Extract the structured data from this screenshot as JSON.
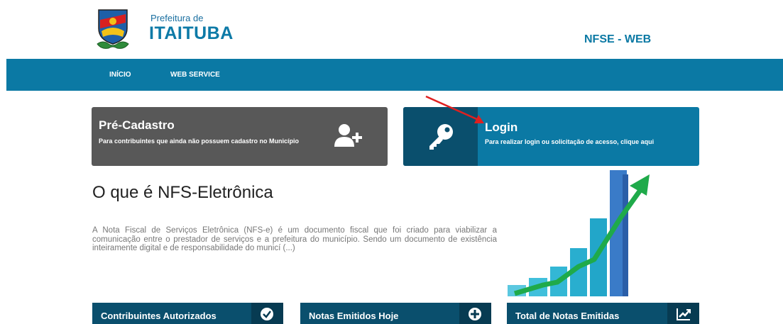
{
  "header": {
    "brand_small": "Prefeitura de",
    "brand_big": "ITAITUBA",
    "app_name": "NFSE - WEB"
  },
  "nav": {
    "items": [
      {
        "label": "INÍCIO"
      },
      {
        "label": "WEB SERVICE"
      }
    ]
  },
  "cards": {
    "pre_cadastro": {
      "title": "Pré-Cadastro",
      "subtitle": "Para contribuintes que ainda não possuem cadastro no Município"
    },
    "login": {
      "title": "Login",
      "subtitle": "Para realizar login ou solicitação de acesso, clique aqui"
    }
  },
  "section": {
    "title": "O que é NFS-Eletrônica",
    "text": "A Nota Fiscal de Serviços Eletrônica (NFS-e) é um documento fiscal que foi criado para viabilizar a comunicação entre o prestador de serviços e a prefeitura do município. Sendo um documento de existência inteiramente digital e de responsabilidade do municí (...)"
  },
  "stats": [
    {
      "label": "Contribuintes Autorizados",
      "icon": "check-circle-icon"
    },
    {
      "label": "Notas Emitidos Hoje",
      "icon": "plus-circle-icon"
    },
    {
      "label": "Total de Notas Emitidas",
      "icon": "trend-up-icon"
    }
  ],
  "colors": {
    "primary": "#0b79a4",
    "dark": "#0a4f6d",
    "gray_card": "#585858",
    "arrow_red": "#e02020",
    "arrow_green": "#1faa4a"
  }
}
